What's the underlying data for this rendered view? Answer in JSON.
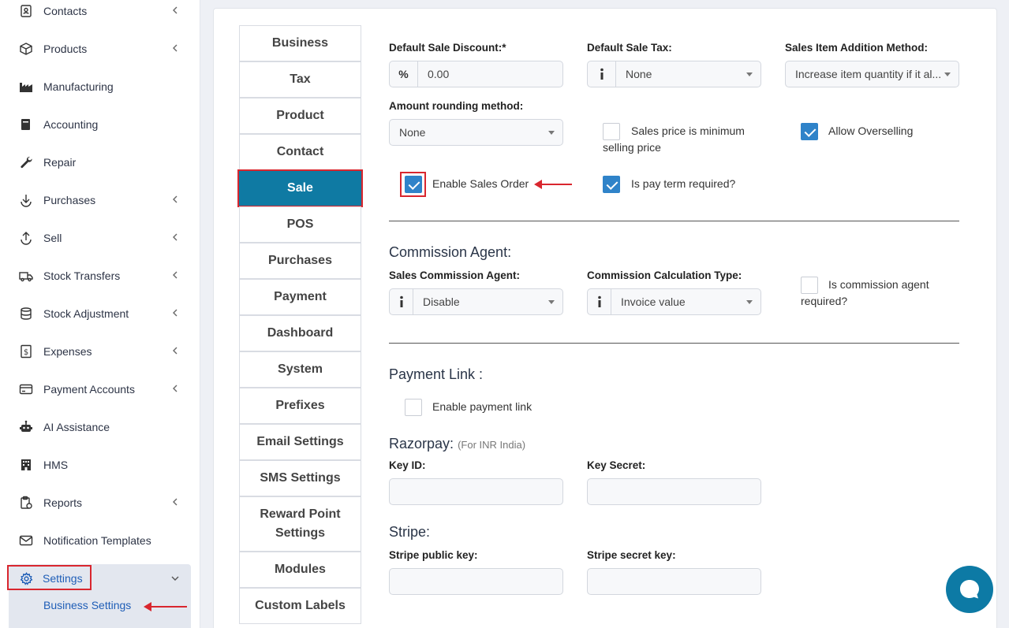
{
  "sidebar": {
    "items": [
      {
        "label": "Contacts",
        "icon": "contacts-icon"
      },
      {
        "label": "Products",
        "icon": "cube-icon"
      },
      {
        "label": "Manufacturing",
        "icon": "factory-icon"
      },
      {
        "label": "Accounting",
        "icon": "book-icon"
      },
      {
        "label": "Repair",
        "icon": "wrench-icon"
      },
      {
        "label": "Purchases",
        "icon": "download-icon"
      },
      {
        "label": "Sell",
        "icon": "upload-icon"
      },
      {
        "label": "Stock Transfers",
        "icon": "truck-icon"
      },
      {
        "label": "Stock Adjustment",
        "icon": "database-icon"
      },
      {
        "label": "Expenses",
        "icon": "dollar-file-icon"
      },
      {
        "label": "Payment Accounts",
        "icon": "credit-card-icon"
      },
      {
        "label": "AI Assistance",
        "icon": "robot-icon"
      },
      {
        "label": "HMS",
        "icon": "building-icon"
      },
      {
        "label": "Reports",
        "icon": "report-icon"
      },
      {
        "label": "Notification Templates",
        "icon": "envelope-icon"
      }
    ],
    "settings_label": "Settings",
    "business_settings_label": "Business Settings"
  },
  "tabs": [
    "Business",
    "Tax",
    "Product",
    "Contact",
    "Sale",
    "POS",
    "Purchases",
    "Payment",
    "Dashboard",
    "System",
    "Prefixes",
    "Email Settings",
    "SMS Settings",
    "Reward Point Settings",
    "Modules",
    "Custom Labels"
  ],
  "active_tab": "Sale",
  "form": {
    "default_sale_discount": {
      "label": "Default Sale Discount:*",
      "addon": "%",
      "value": "0.00"
    },
    "default_sale_tax": {
      "label": "Default Sale Tax:",
      "value": "None"
    },
    "sales_item_addition": {
      "label": "Sales Item Addition Method:",
      "value": "Increase item quantity if it al..."
    },
    "amount_rounding": {
      "label": "Amount rounding method:",
      "value": "None"
    },
    "sales_price_minimum": {
      "label_line1": "Sales price is minimum",
      "label_line2": "selling price",
      "checked": false
    },
    "allow_overselling": {
      "label": "Allow Overselling",
      "checked": true
    },
    "enable_sales_order": {
      "label": "Enable Sales Order",
      "checked": true
    },
    "pay_term_required": {
      "label": "Is pay term required?",
      "checked": true
    },
    "commission_section": "Commission Agent:",
    "sales_commission_agent": {
      "label": "Sales Commission Agent:",
      "value": "Disable"
    },
    "commission_calc_type": {
      "label": "Commission Calculation Type:",
      "value": "Invoice value"
    },
    "commission_agent_required": {
      "label_line1": "Is commission agent",
      "label_line2": "required?",
      "checked": false
    },
    "payment_link_section": "Payment Link :",
    "enable_payment_link": {
      "label": "Enable payment link",
      "checked": false
    },
    "razorpay_title": "Razorpay:",
    "razorpay_sub": "(For INR India)",
    "key_id_label": "Key ID:",
    "key_secret_label": "Key Secret:",
    "stripe_title": "Stripe:",
    "stripe_public_label": "Stripe public key:",
    "stripe_secret_label": "Stripe secret key:"
  },
  "colors": {
    "accent": "#0f7aa3",
    "link": "#1f5eb7",
    "annotation": "#d9262e",
    "checkbox": "#2f83c9"
  }
}
